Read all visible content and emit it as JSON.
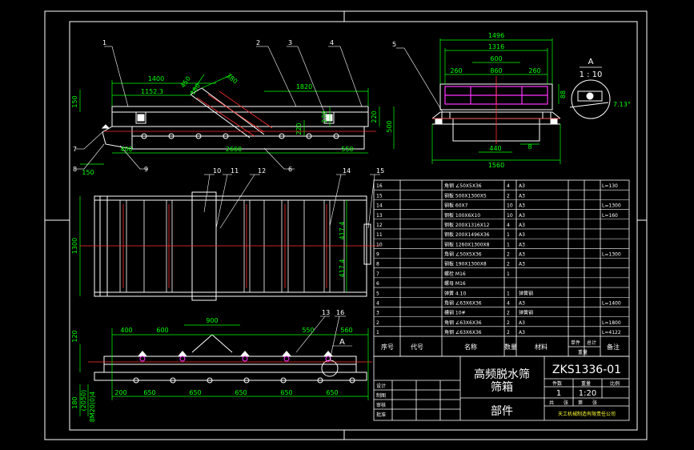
{
  "colors": {
    "background": "#000000",
    "linework": "#ffffff",
    "dimensions": "#00ff00",
    "centerlines": "#ff3030",
    "screen_panels": "#ff33ff",
    "title_text": "#ffffff",
    "company_text": "#ffff33"
  },
  "side_view": {
    "dims": {
      "d1400": "1400",
      "d1152": "1152.3",
      "d450": "450",
      "d180": "180",
      "d380": "380",
      "d1820": "1820",
      "d150": "150",
      "d220": "220",
      "d270": "270",
      "d500": "500",
      "d2660": "2660",
      "d400": "400",
      "d550": "550",
      "d150b": "150",
      "d6": "6"
    },
    "callouts": {
      "c1": "1",
      "c2": "2",
      "c3": "3",
      "c4": "4",
      "c6": "6",
      "c7": "7",
      "c8": "8",
      "c9": "9"
    }
  },
  "end_view": {
    "dims": {
      "d1496": "1496",
      "d1316": "1316",
      "d600": "600",
      "d260a": "260",
      "d860": "860",
      "d260b": "260",
      "d88": "88",
      "d440": "440",
      "d8": "8",
      "d1560": "1560"
    },
    "callouts": {
      "c5": "5"
    }
  },
  "detail_a": {
    "label": "A",
    "scale": "1 : 10",
    "angle": "7.13°"
  },
  "plan_view": {
    "dims": {
      "d1300": "1300",
      "d417a": "417.4",
      "d417b": "417.4"
    },
    "callouts": {
      "c10": "10",
      "c11": "11",
      "c12": "12",
      "c14": "14",
      "c15": "15"
    }
  },
  "bottom_view": {
    "dims": {
      "d900": "900",
      "d400": "400",
      "d600": "600",
      "d550": "550",
      "d560": "560",
      "d120": "120",
      "d180": "180",
      "d200": "200",
      "d650a": "650",
      "d650b": "650",
      "d650c": "650",
      "d650d": "650",
      "d650e": "650",
      "d2050": "(2050)",
      "dM": "8M20(0)4"
    },
    "callouts": {
      "c13": "13",
      "c16": "16",
      "cA": "A"
    }
  },
  "bom": {
    "rows": [
      {
        "no": "16",
        "code": "",
        "name": "角钢 ∠50X5X36",
        "qty": "4",
        "mat": "A3",
        "note": "L=130"
      },
      {
        "no": "15",
        "code": "",
        "name": "钢板 500X1300X5",
        "qty": "2",
        "mat": "A3",
        "note": ""
      },
      {
        "no": "14",
        "code": "",
        "name": "钢板 60X7",
        "qty": "10",
        "mat": "A3",
        "note": "L=1300"
      },
      {
        "no": "13",
        "code": "",
        "name": "钢板 100X6X10",
        "qty": "10",
        "mat": "A3",
        "note": "L=160"
      },
      {
        "no": "12",
        "code": "",
        "name": "钢板 200X1316X12",
        "qty": "4",
        "mat": "A3",
        "note": ""
      },
      {
        "no": "11",
        "code": "",
        "name": "钢板 200X1496X36",
        "qty": "1",
        "mat": "A3",
        "note": ""
      },
      {
        "no": "10",
        "code": "",
        "name": "钢板 1260X1300X8",
        "qty": "1",
        "mat": "A3",
        "note": ""
      },
      {
        "no": "9",
        "code": "",
        "name": "角钢 ∠50X5X36",
        "qty": "2",
        "mat": "A3",
        "note": "L=1300"
      },
      {
        "no": "8",
        "code": "",
        "name": "钢板 190X1300X8",
        "qty": "2",
        "mat": "A3",
        "note": ""
      },
      {
        "no": "7",
        "code": "",
        "name": "螺栓 M16",
        "qty": "1",
        "mat": "",
        "note": ""
      },
      {
        "no": "6",
        "code": "",
        "name": "螺母 M16",
        "qty": "",
        "mat": "",
        "note": ""
      },
      {
        "no": "5",
        "code": "",
        "name": "弹簧 4.10",
        "qty": "1",
        "mat": "弹簧钢",
        "note": ""
      },
      {
        "no": "4",
        "code": "",
        "name": "角钢 ∠63X6X36",
        "qty": "4",
        "mat": "A3",
        "note": "L=1400"
      },
      {
        "no": "3",
        "code": "",
        "name": "槽钢 10#",
        "qty": "2",
        "mat": "弹簧钢",
        "note": ""
      },
      {
        "no": "2",
        "code": "",
        "name": "角钢 ∠63X6X36",
        "qty": "2",
        "mat": "A3",
        "note": "L=1800"
      },
      {
        "no": "1",
        "code": "",
        "name": "角钢 ∠63X6X36",
        "qty": "2",
        "mat": "A3",
        "note": "L=4122"
      }
    ],
    "header": {
      "no": "序号",
      "code": "代号",
      "name": "名称",
      "qty": "数量",
      "mat": "材料",
      "unit_w": "单件",
      "total_w": "总计",
      "weight": "重量",
      "note": "备注"
    }
  },
  "title_block": {
    "title_line1": "高频脱水筛",
    "title_line2": "筛箱",
    "subtitle": "部件",
    "drawing_no": "ZKS1336-01",
    "qty_label": "件数",
    "weight_label": "重量",
    "scale_label": "比例",
    "qty": "1",
    "scale": "1:20",
    "sheet_a": "共",
    "sheet_b": "张",
    "sheet_c": "第",
    "sheet_d": "张",
    "role_design": "设计",
    "role_draw": "制图",
    "role_check": "审核",
    "role_approve": "批准",
    "company": "天工机械制造有限责任公司"
  }
}
